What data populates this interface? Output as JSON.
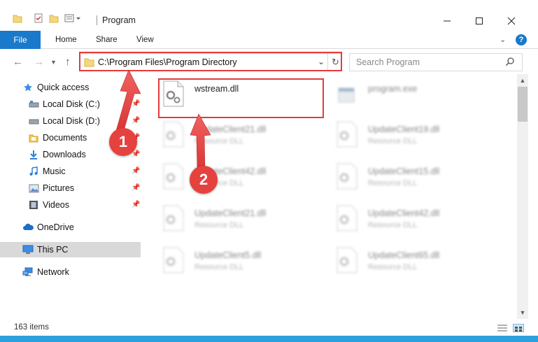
{
  "window": {
    "title": "Program"
  },
  "ribbon": {
    "tabs": [
      "File",
      "Home",
      "Share",
      "View"
    ],
    "help": "?"
  },
  "address": {
    "path": "C:\\Program Files\\Program Directory"
  },
  "search": {
    "placeholder": "Search Program"
  },
  "sidebar": {
    "items": [
      {
        "label": "Quick access",
        "icon": "star-icon"
      },
      {
        "label": "Local Disk (C:)",
        "icon": "drive-icon",
        "pinned": true
      },
      {
        "label": "Local Disk (D:)",
        "icon": "drive-icon",
        "pinned": true
      },
      {
        "label": "Documents",
        "icon": "documents-icon",
        "pinned": true
      },
      {
        "label": "Downloads",
        "icon": "download-icon",
        "pinned": true
      },
      {
        "label": "Music",
        "icon": "music-icon",
        "pinned": true
      },
      {
        "label": "Pictures",
        "icon": "pictures-icon",
        "pinned": true
      },
      {
        "label": "Videos",
        "icon": "videos-icon",
        "pinned": true
      },
      {
        "label": "OneDrive",
        "icon": "cloud-icon"
      },
      {
        "label": "This PC",
        "icon": "computer-icon",
        "selected": true
      },
      {
        "label": "Network",
        "icon": "network-icon"
      }
    ]
  },
  "files": [
    {
      "name": "wstream.dll",
      "type": "",
      "highlighted": true
    },
    {
      "name": "program.exe",
      "type": ""
    },
    {
      "name": "UpdateClient21.dll",
      "type": "Resource DLL"
    },
    {
      "name": "UpdateClient19.dll",
      "type": "Resource DLL"
    },
    {
      "name": "UpdateClient42.dll",
      "type": "Resource DLL"
    },
    {
      "name": "UpdateClient15.dll",
      "type": "Resource DLL"
    },
    {
      "name": "UpdateClient21.dll",
      "type": "Resource DLL"
    },
    {
      "name": "UpdateClient42.dll",
      "type": "Resource DLL"
    },
    {
      "name": "UpdateClient5.dll",
      "type": "Resource DLL"
    },
    {
      "name": "UpdateClient65.dll",
      "type": "Resource DLL"
    }
  ],
  "status": {
    "items": "163 items"
  },
  "annotations": {
    "step1": "1",
    "step2": "2"
  },
  "colors": {
    "accent": "#1979ca",
    "highlight": "#e23b3b",
    "selection": "#d9d9d9"
  }
}
